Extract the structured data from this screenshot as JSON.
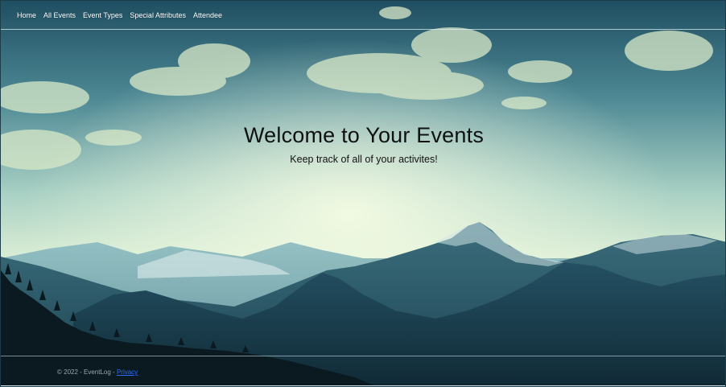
{
  "nav": {
    "items": [
      {
        "label": "Home"
      },
      {
        "label": "All Events"
      },
      {
        "label": "Event Types"
      },
      {
        "label": "Special Attributes"
      },
      {
        "label": "Attendee"
      }
    ]
  },
  "hero": {
    "title": "Welcome to Your Events",
    "subtitle": "Keep track of all of your activites!"
  },
  "footer": {
    "copyright": "© 2022 - EventLog - ",
    "privacy_link": "Privacy"
  },
  "colors": {
    "sky_top": "#1f5366",
    "sky_glow": "#e9f4d8",
    "mountain_dark": "#15313e",
    "forest": "#0b1a1f"
  }
}
